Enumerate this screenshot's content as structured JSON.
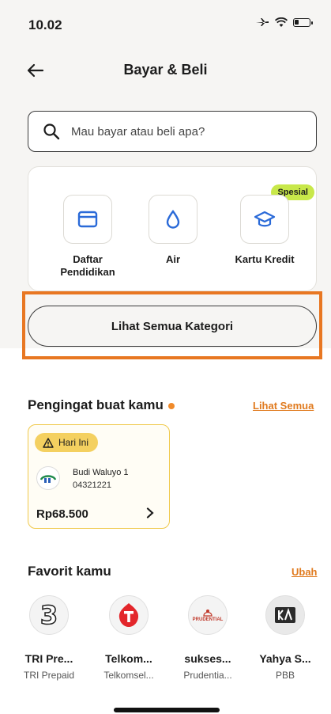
{
  "status": {
    "time": "10.02"
  },
  "header": {
    "title": "Bayar & Beli"
  },
  "search": {
    "placeholder": "Mau bayar atau beli apa?"
  },
  "categories": [
    {
      "label": "Daftar Pendidikan",
      "icon": "card-icon"
    },
    {
      "label": "Air",
      "icon": "water-drop-icon"
    },
    {
      "label": "Kartu Kredit",
      "icon": "graduation-cap-icon",
      "badge": "Spesial"
    }
  ],
  "see_all_categories": "Lihat Semua Kategori",
  "reminders": {
    "title": "Pengingat buat kamu",
    "see_all": "Lihat Semua",
    "item": {
      "tag": "Hari Ini",
      "name": "Budi Waluyo 1",
      "id": "04321221",
      "amount": "Rp68.500"
    }
  },
  "favorites": {
    "title": "Favorit kamu",
    "edit": "Ubah",
    "items": [
      {
        "name": "TRI Pre...",
        "sub": "TRI Prepaid"
      },
      {
        "name": "Telkom...",
        "sub": "Telkomsel..."
      },
      {
        "name": "sukses...",
        "sub": "Prudentia..."
      },
      {
        "name": "Yahya S...",
        "sub": "PBB"
      }
    ],
    "logos": [
      "3",
      "PRUDENTIAL"
    ]
  },
  "colors": {
    "accent": "#e07a1e",
    "highlight": "#e87722",
    "badge": "#c8e84a",
    "today": "#f4d060"
  }
}
